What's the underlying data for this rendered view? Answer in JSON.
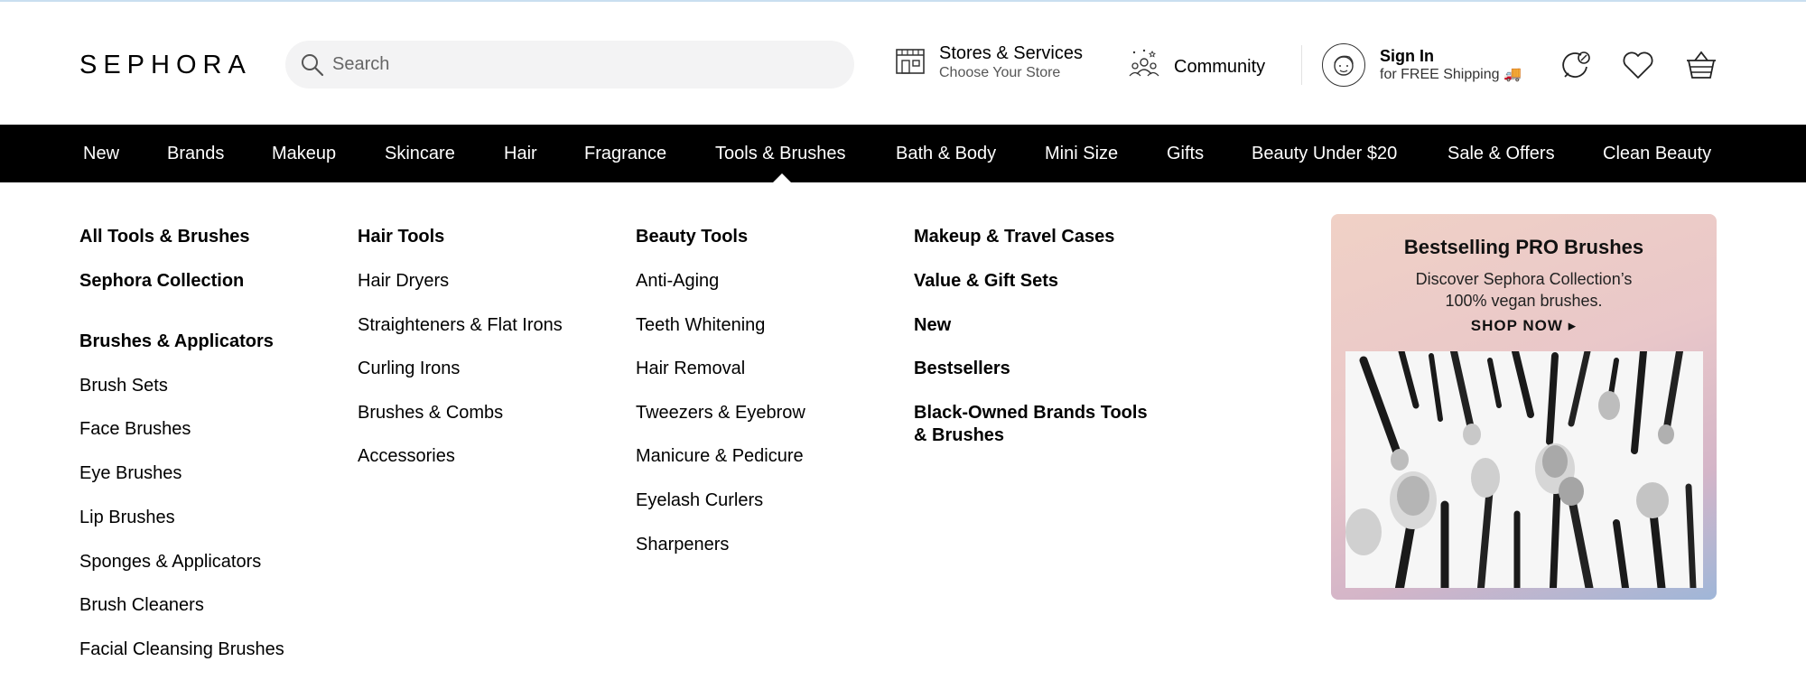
{
  "brand": {
    "logo_text": "SEPHORA"
  },
  "search": {
    "placeholder": "Search"
  },
  "header": {
    "stores": {
      "title": "Stores & Services",
      "subtitle": "Choose Your Store"
    },
    "community": {
      "label": "Community"
    },
    "signin": {
      "title": "Sign In",
      "subtitle": "for FREE Shipping 🚚"
    }
  },
  "nav": {
    "items": [
      "New",
      "Brands",
      "Makeup",
      "Skincare",
      "Hair",
      "Fragrance",
      "Tools & Brushes",
      "Bath & Body",
      "Mini Size",
      "Gifts",
      "Beauty Under $20",
      "Sale & Offers",
      "Clean Beauty"
    ],
    "active": "Tools & Brushes"
  },
  "menu": {
    "col1": {
      "all": "All Tools & Brushes",
      "collection": "Sephora Collection",
      "heading": "Brushes & Applicators",
      "links": [
        "Brush Sets",
        "Face Brushes",
        "Eye Brushes",
        "Lip Brushes",
        "Sponges & Applicators",
        "Brush Cleaners",
        "Facial Cleansing Brushes"
      ]
    },
    "col2": {
      "heading": "Hair Tools",
      "links": [
        "Hair Dryers",
        "Straighteners & Flat Irons",
        "Curling Irons",
        "Brushes & Combs",
        "Accessories"
      ]
    },
    "col3": {
      "heading": "Beauty Tools",
      "links": [
        "Anti-Aging",
        "Teeth Whitening",
        "Hair Removal",
        "Tweezers & Eyebrow",
        "Manicure & Pedicure",
        "Eyelash Curlers",
        "Sharpeners"
      ]
    },
    "col4": {
      "links": [
        "Makeup & Travel Cases",
        "Value & Gift Sets",
        "New",
        "Bestsellers",
        "Black-Owned Brands Tools",
        "& Brushes"
      ]
    }
  },
  "promo": {
    "title": "Bestselling PRO Brushes",
    "subtitle_line1": "Discover Sephora Collection’s",
    "subtitle_line2": "100% vegan brushes.",
    "cta": "SHOP NOW ▸"
  },
  "icons": {
    "search": "search-icon",
    "stores": "store-icon",
    "community": "community-icon",
    "avatar": "avatar-icon",
    "chat": "chat-icon",
    "heart": "heart-icon",
    "basket": "basket-icon"
  }
}
